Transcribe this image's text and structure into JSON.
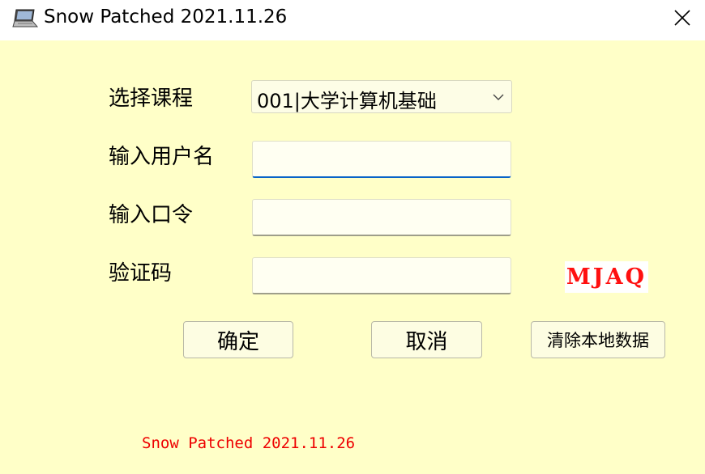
{
  "window": {
    "title": "Snow Patched 2021.11.26",
    "icon": "laptop-icon",
    "close_icon": "close-icon"
  },
  "form": {
    "course_label": "选择课程",
    "course_value": "001|大学计算机基础",
    "username_label": "输入用户名",
    "username_value": "",
    "password_label": "输入口令",
    "password_value": "",
    "captcha_label": "验证码",
    "captcha_value": "",
    "captcha_text": "MJAQ"
  },
  "buttons": {
    "ok_label": "确定",
    "cancel_label": "取消",
    "clear_label": "清除本地数据"
  },
  "footer": {
    "text": "Snow Patched 2021.11.26"
  },
  "colors": {
    "background": "#ffffc8",
    "accent": "#0a64c8",
    "captcha_text": "#ff1010",
    "footer_text": "#ee0000"
  }
}
